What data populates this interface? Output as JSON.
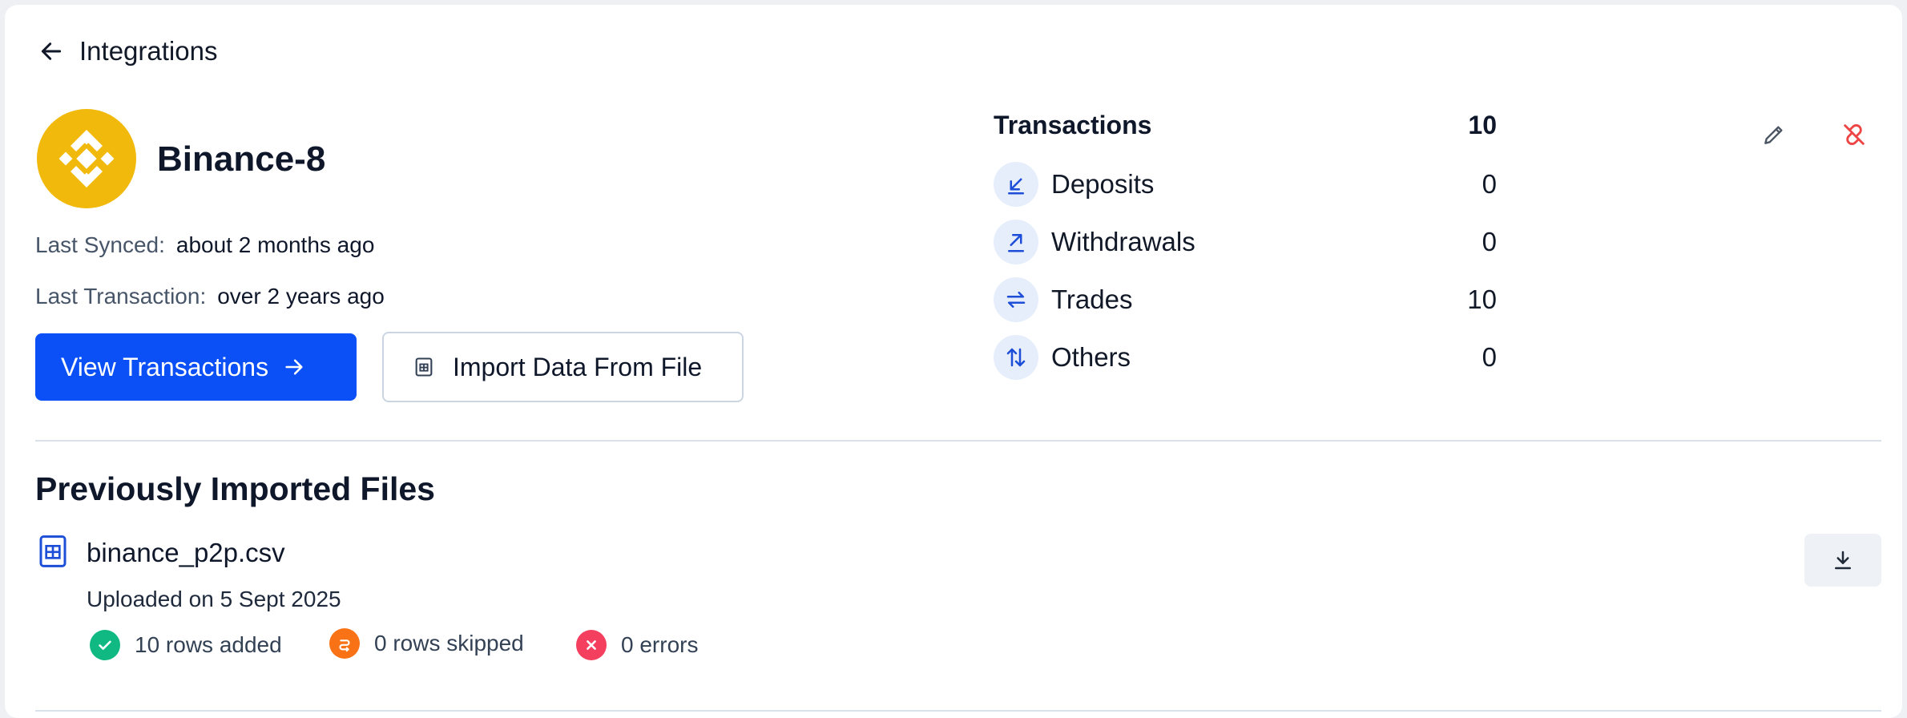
{
  "header": {
    "title": "Integrations"
  },
  "integration": {
    "name": "Binance-8",
    "brand_color": "#f0b90b",
    "last_synced_label": "Last Synced:",
    "last_synced_value": "about 2 months ago",
    "last_transaction_label": "Last Transaction:",
    "last_transaction_value": "over 2 years ago"
  },
  "actions": {
    "view_transactions": "View Transactions",
    "import_file": "Import Data From File",
    "primary_color": "#0b50f7"
  },
  "stats": {
    "title": "Transactions",
    "total": "10",
    "rows": [
      {
        "label": "Deposits",
        "value": "0",
        "icon": "arrow-down-left-icon"
      },
      {
        "label": "Withdrawals",
        "value": "0",
        "icon": "arrow-up-right-icon"
      },
      {
        "label": "Trades",
        "value": "10",
        "icon": "swap-icon"
      },
      {
        "label": "Others",
        "value": "0",
        "icon": "up-down-arrows-icon"
      }
    ]
  },
  "imports": {
    "title": "Previously Imported Files",
    "files": [
      {
        "name": "binance_p2p.csv",
        "uploaded": "Uploaded on 5 Sept 2025",
        "added": "10 rows added",
        "skipped": "0 rows skipped",
        "errors": "0 errors"
      }
    ]
  },
  "colors": {
    "success": "#10b981",
    "warning": "#f97316",
    "error": "#f43f5e",
    "unlink": "#ef4444"
  }
}
